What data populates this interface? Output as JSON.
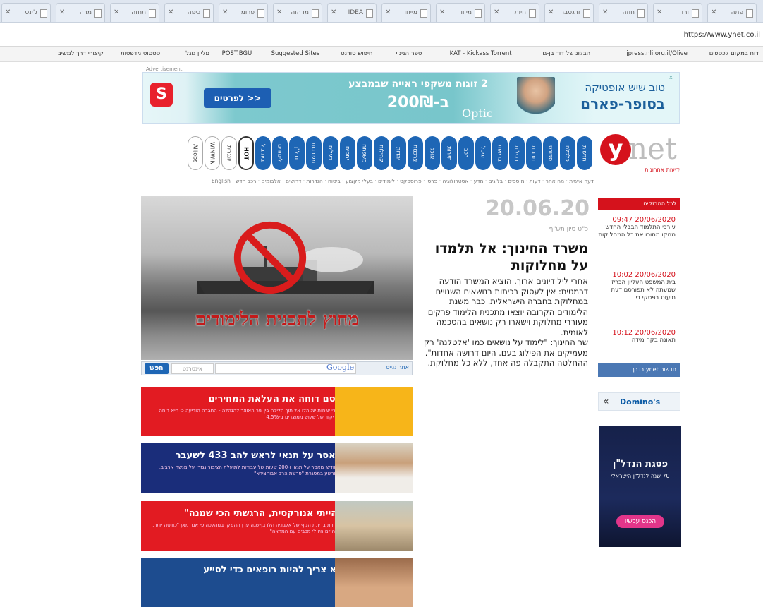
{
  "browser": {
    "tabs": [
      "ג'ינס",
      "מרה",
      "תחזה",
      "כיפה",
      "פרומו",
      "מו הוה",
      "IDEA",
      "מייחו",
      "מיווו",
      "חיות",
      "זרגסבר",
      "חוזה",
      "ורד",
      "פתה"
    ],
    "url": "https://www.ynet.co.il",
    "bookmarks": [
      "דוח במקום לכספים",
      "jpress.nli.org.il/Olive",
      "הבלוג של דוד בן-גו",
      "KAT - Kickass Torrent",
      "ספר הגינוי",
      "חיפוש טורנט",
      "Suggested Sites",
      "POST.BGU",
      "מליון גוגל",
      "סטטוס מדפסות",
      "קיצורי דרך למשיב"
    ]
  },
  "ad": {
    "label": "Advertisement",
    "button": "לפרטים >>",
    "line1": "2 זוגות משקפי ראייה שבמבצע",
    "line2": "ב-200₪",
    "brand": "Optic",
    "right1": "טוב שיש אופטיקה",
    "right2": "בסופר-פארם",
    "close": "x"
  },
  "logo": {
    "letter": "y",
    "word": "net",
    "slogan": "ידיעות אחרונות"
  },
  "nav": [
    "חדשות",
    "כלכלה",
    "ספורט",
    "תרבות",
    "רכילות",
    "בריאות",
    "דיגיטל",
    "רכב",
    "תיירות",
    "אוכל",
    "צרכנות",
    "יהדות",
    "קהילות",
    "משפחה",
    "יחסים",
    "בעלים",
    "מעורבות",
    "נדל\"ן",
    "לימודים",
    "בית ביל",
    "HOT",
    "יונגרית",
    "WINWIN",
    "AllJobs"
  ],
  "subnav": "דעה אישית · מה אחר · דעות · מוספים · בלוגים · מדע · אסטרולוגיה · פרסי · פרוספקט · לימודים · בעלי מקצוע · ביטוח · הגדרות · דרושים · אלבומים · רכב חדש · English",
  "hero": {
    "caption": "מחוץ לתכנית הלימודים"
  },
  "search": {
    "button": "חפש",
    "select": "אינטרנט",
    "google": "Google",
    "other": "אתר ננייס"
  },
  "promos": [
    {
      "title": "אסם דוחה את העלאת המחירים",
      "desc": "אחרי שיחות שנוהלו אל תוך הלילה בין שר האוצר להנהלה - החברה הודיעה כי היא דוחה את יקור של שלוש ממוצרים ב-4.5%"
    },
    {
      "title": "מאסר על תנאי לראש להב 433 לשעבר",
      "desc": "4 חודשי מאסר על תנאי ו-200 שעות של עבודות לתועלת הציבור נגזרו על מנשה ארביב, שהורשע במסגרת \"פרשת הרב אבוחצירא\""
    },
    {
      "title": "\"הייתי אנורקסית, הרגשתי הכי שמנה\"",
      "desc": "ביקורת בדיונת הגוף של אלגוניה הלו בן-שגה ערן ההשק, במהלכה פי אנד מאן \"כוויסה יותר, כל הויים היו לי מכבים עם המראה\""
    },
    {
      "title": "לא צריך להיות רופאים כדי לסייע",
      "desc": ""
    }
  ],
  "article": {
    "date": "20.06.20",
    "hebrew_date": "כ\"ט סיון תש\"ף",
    "headline": "משרד החינוך: אל תלמדו על מחלוקות",
    "paragraphs": [
      "אחרי ליל דיונים ארוך, הוציא המשרד הודעה דרמטית: אין לעסוק בכיתות בנושאים השנויים במחלוקת בחברה הישראלית. כבר משנת הלימודים הקרובה יוצאו מתכנית הלימוד פרקים מעוררי מחלוקת וישארו רק נושאים בהסכמה לאומית.",
      "שר החינוך: \"לימוד על נושאים כמו 'אלטלנה' רק מעמיקים את הפילוג בעם. היום דרושה אחדות\".",
      "ההחלטה התקבלה פה אחד, ללא כל מחלוקת."
    ]
  },
  "flash": {
    "header": "לכל המבזקים",
    "items": [
      {
        "time": "20/06/2020 09:47",
        "text": "עורכי התלמוד הבבלי החדש מחקו מתוכו את כל המחלוקות"
      },
      {
        "time": "20/06/2020 10:02",
        "text": "בית המשפט העליון הכריז שמעתה לא תפורסם דעת מיעוט בפסקי דין"
      },
      {
        "time": "20/06/2020 10:12",
        "text": "תאונה בקה מידה"
      }
    ],
    "widget": "חדשות ynet בדרך"
  },
  "dominos": {
    "brand": "Domino's",
    "arrow": "«"
  },
  "side_ad": {
    "title": "פסגת הנדל\"ן",
    "subtitle": "70 שנה לנדל\"ן הישראלי",
    "button": "הכנס עכשיו"
  },
  "colors": {
    "ynet_red": "#d5121c",
    "nav_blue": "#1e66b5"
  }
}
